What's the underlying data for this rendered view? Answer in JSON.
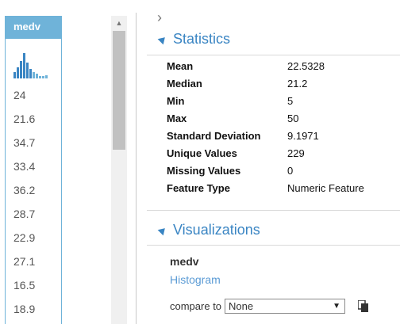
{
  "column": {
    "name": "medv",
    "values": [
      "24",
      "21.6",
      "34.7",
      "33.4",
      "36.2",
      "28.7",
      "22.9",
      "27.1",
      "16.5",
      "18.9"
    ]
  },
  "icons": {
    "expand": "chevron-right-icon",
    "collapse": "triangle-collapse-icon",
    "copy": "copy-icon",
    "scroll_up": "scroll-up-arrow-icon",
    "dropdown": "dropdown-arrow-icon"
  },
  "statistics": {
    "title": "Statistics",
    "rows": [
      {
        "label": "Mean",
        "value": "22.5328"
      },
      {
        "label": "Median",
        "value": "21.2"
      },
      {
        "label": "Min",
        "value": "5"
      },
      {
        "label": "Max",
        "value": "50"
      },
      {
        "label": "Standard Deviation",
        "value": "9.1971"
      },
      {
        "label": "Unique Values",
        "value": "229"
      },
      {
        "label": "Missing Values",
        "value": "0"
      },
      {
        "label": "Feature Type",
        "value": "Numeric Feature"
      }
    ]
  },
  "visualizations": {
    "title": "Visualizations",
    "variable": "medv",
    "chart_link": "Histogram",
    "compare_label": "compare to",
    "compare_selected": "None"
  },
  "colors": {
    "accent": "#6fb3d9",
    "link": "#3a85c3"
  }
}
